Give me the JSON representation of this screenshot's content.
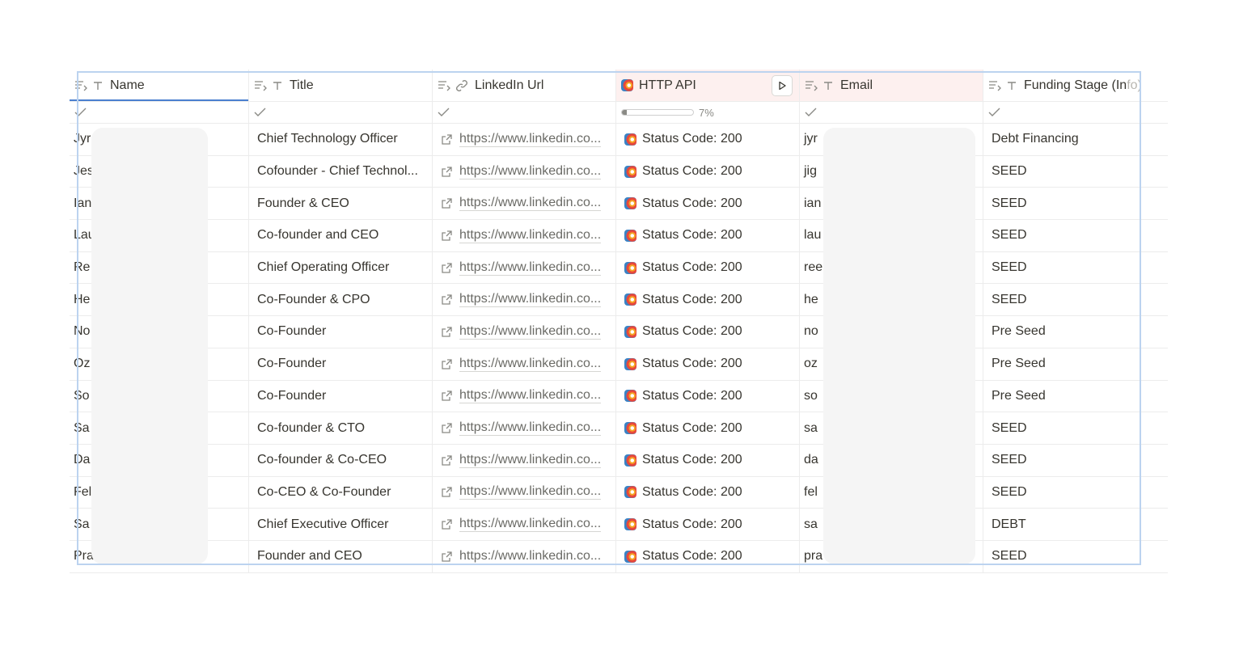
{
  "columns": [
    {
      "label": "Name",
      "icon": "text-type-icon"
    },
    {
      "label": "Title",
      "icon": "text-type-icon"
    },
    {
      "label": "LinkedIn Url",
      "icon": "link-icon"
    },
    {
      "label": "HTTP API",
      "icon": "http-api-icon"
    },
    {
      "label": "Email",
      "icon": "text-type-icon"
    },
    {
      "label": "Funding Stage (Info)",
      "icon": "text-type-icon",
      "visible": "Funding Stage (In",
      "faded": "fo)"
    }
  ],
  "progress": {
    "value": 0.07,
    "label": "7%"
  },
  "rows": [
    {
      "name": "Jyr",
      "title": "Chief Technology Officer",
      "url": "https://www.linkedin.co...",
      "api": "Status Code: 200",
      "email": "jyr",
      "funding": "Debt Financing"
    },
    {
      "name": "Jes",
      "title": "Cofounder - Chief Technol...",
      "url": "https://www.linkedin.co...",
      "api": "Status Code: 200",
      "email": "jig",
      "funding": "SEED"
    },
    {
      "name": "Ian",
      "title": "Founder & CEO",
      "url": "https://www.linkedin.co...",
      "api": "Status Code: 200",
      "email": "ian",
      "funding": "SEED"
    },
    {
      "name": "Lau",
      "title": "Co-founder and CEO",
      "url": "https://www.linkedin.co...",
      "api": "Status Code: 200",
      "email": "lau",
      "funding": "SEED"
    },
    {
      "name": "Re",
      "title": "Chief Operating Officer",
      "url": "https://www.linkedin.co...",
      "api": "Status Code: 200",
      "email": "ree",
      "funding": "SEED"
    },
    {
      "name": "He",
      "title": "Co-Founder & CPO",
      "url": "https://www.linkedin.co...",
      "api": "Status Code: 200",
      "email": "he",
      "funding": "SEED"
    },
    {
      "name": "No",
      "title": "Co-Founder",
      "url": "https://www.linkedin.co...",
      "api": "Status Code: 200",
      "email": "no",
      "funding": "Pre Seed"
    },
    {
      "name": "Oz",
      "title": "Co-Founder",
      "url": "https://www.linkedin.co...",
      "api": "Status Code: 200",
      "email": "oz",
      "funding": "Pre Seed"
    },
    {
      "name": "So",
      "title": "Co-Founder",
      "url": "https://www.linkedin.co...",
      "api": "Status Code: 200",
      "email": "so",
      "funding": "Pre Seed"
    },
    {
      "name": "Sa",
      "title": "Co-founder & CTO",
      "url": "https://www.linkedin.co...",
      "api": "Status Code: 200",
      "email": "sa",
      "funding": "SEED"
    },
    {
      "name": "Da",
      "title": "Co-founder & Co-CEO",
      "url": "https://www.linkedin.co...",
      "api": "Status Code: 200",
      "email": "da",
      "funding": "SEED"
    },
    {
      "name": "Fel",
      "title": "Co-CEO & Co-Founder",
      "url": "https://www.linkedin.co...",
      "api": "Status Code: 200",
      "email": "fel",
      "funding": "SEED"
    },
    {
      "name": "Sa",
      "title": "Chief Executive Officer",
      "url": "https://www.linkedin.co...",
      "api": "Status Code: 200",
      "email": "sa",
      "funding": "DEBT"
    },
    {
      "name": "Pra",
      "title": "Founder and CEO",
      "url": "https://www.linkedin.co...",
      "api": "Status Code: 200",
      "email": "pra",
      "funding": "SEED"
    }
  ],
  "colors": {
    "accent": "#4a7fcf",
    "selection": "#bcd3ef",
    "api_header_bg": "#fdf0ef"
  }
}
